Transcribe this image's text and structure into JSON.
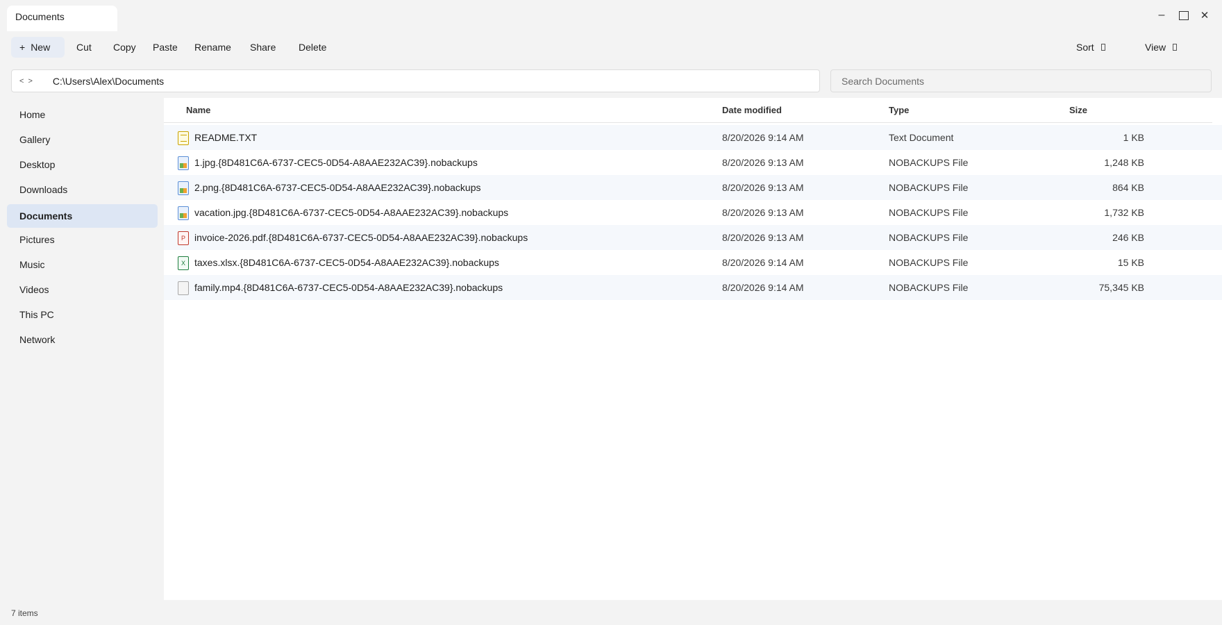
{
  "window": {
    "tab_title": "Documents",
    "minimize_glyph": "–",
    "close_glyph": "✕"
  },
  "toolbar": {
    "new_label": "New",
    "new_icon": "+",
    "cut_label": "Cut",
    "copy_label": "Copy",
    "paste_label": "Paste",
    "rename_label": "Rename",
    "share_label": "Share",
    "delete_label": "Delete",
    "sort_label": "Sort",
    "view_label": "View"
  },
  "address": {
    "back_glyph": "<",
    "forward_glyph": ">",
    "path": "C:\\Users\\Alex\\Documents"
  },
  "search": {
    "placeholder": "Search Documents",
    "value": ""
  },
  "sidebar": {
    "items": [
      {
        "label": "Home",
        "active": false
      },
      {
        "label": "Gallery",
        "active": false
      },
      {
        "label": "Desktop",
        "active": false
      },
      {
        "label": "Downloads",
        "active": false
      },
      {
        "label": "Documents",
        "active": true
      },
      {
        "label": "Pictures",
        "active": false
      },
      {
        "label": "Music",
        "active": false
      },
      {
        "label": "Videos",
        "active": false
      },
      {
        "label": "This PC",
        "active": false
      },
      {
        "label": "Network",
        "active": false
      }
    ]
  },
  "columns": {
    "name": "Name",
    "date": "Date modified",
    "type": "Type",
    "size": "Size"
  },
  "files": [
    {
      "icon": "text-file-icon",
      "icon_text": "",
      "name": "README.TXT",
      "date": "8/20/2026 9:14 AM",
      "type": "Text Document",
      "size": "1 KB"
    },
    {
      "icon": "image-file-icon",
      "icon_text": "",
      "name": "1.jpg.{8D481C6A-6737-CEC5-0D54-A8AAE232AC39}.nobackups",
      "date": "8/20/2026 9:13 AM",
      "type": "NOBACKUPS File",
      "size": "1,248 KB"
    },
    {
      "icon": "image-file-icon",
      "icon_text": "",
      "name": "2.png.{8D481C6A-6737-CEC5-0D54-A8AAE232AC39}.nobackups",
      "date": "8/20/2026 9:13 AM",
      "type": "NOBACKUPS File",
      "size": "864 KB"
    },
    {
      "icon": "image-file-icon",
      "icon_text": "",
      "name": "vacation.jpg.{8D481C6A-6737-CEC5-0D54-A8AAE232AC39}.nobackups",
      "date": "8/20/2026 9:13 AM",
      "type": "NOBACKUPS File",
      "size": "1,732 KB"
    },
    {
      "icon": "pdf-file-icon",
      "icon_text": "P",
      "name": "invoice-2026.pdf.{8D481C6A-6737-CEC5-0D54-A8AAE232AC39}.nobackups",
      "date": "8/20/2026 9:13 AM",
      "type": "NOBACKUPS File",
      "size": "246 KB"
    },
    {
      "icon": "excel-file-icon",
      "icon_text": "X",
      "name": "taxes.xlsx.{8D481C6A-6737-CEC5-0D54-A8AAE232AC39}.nobackups",
      "date": "8/20/2026 9:14 AM",
      "type": "NOBACKUPS File",
      "size": "15 KB"
    },
    {
      "icon": "generic-file-icon",
      "icon_text": "",
      "name": "family.mp4.{8D481C6A-6737-CEC5-0D54-A8AAE232AC39}.nobackups",
      "date": "8/20/2026 9:14 AM",
      "type": "NOBACKUPS File",
      "size": "75,345 KB"
    }
  ],
  "status": {
    "item_count": "7 items"
  }
}
